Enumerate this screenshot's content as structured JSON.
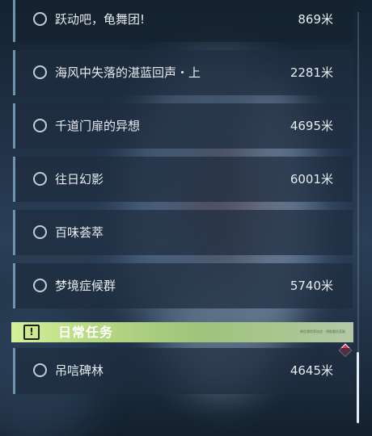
{
  "quests": [
    {
      "name": "跃动吧，龟舞团!",
      "distance": "869米"
    },
    {
      "name": "海风中失落的湛蓝回声・上",
      "distance": "2281米"
    },
    {
      "name": "千道门扉的异想",
      "distance": "4695米"
    },
    {
      "name": "往日幻影",
      "distance": "6001米"
    },
    {
      "name": "百味荟萃",
      "distance": ""
    },
    {
      "name": "梦境症候群",
      "distance": "5740米"
    }
  ],
  "daily": {
    "badge_icon": "exclamation-icon",
    "badge_glyph": "!",
    "title": "日常任务",
    "note": "前往冒险家协会 · 领取委托奖励",
    "quests": [
      {
        "name": "吊唁碑林",
        "distance": "4645米"
      }
    ]
  },
  "colors": {
    "header_accent": "#b5d882",
    "marker": "#e0384a",
    "text": "#e8ecf0",
    "row_border": "#6e93ad"
  }
}
